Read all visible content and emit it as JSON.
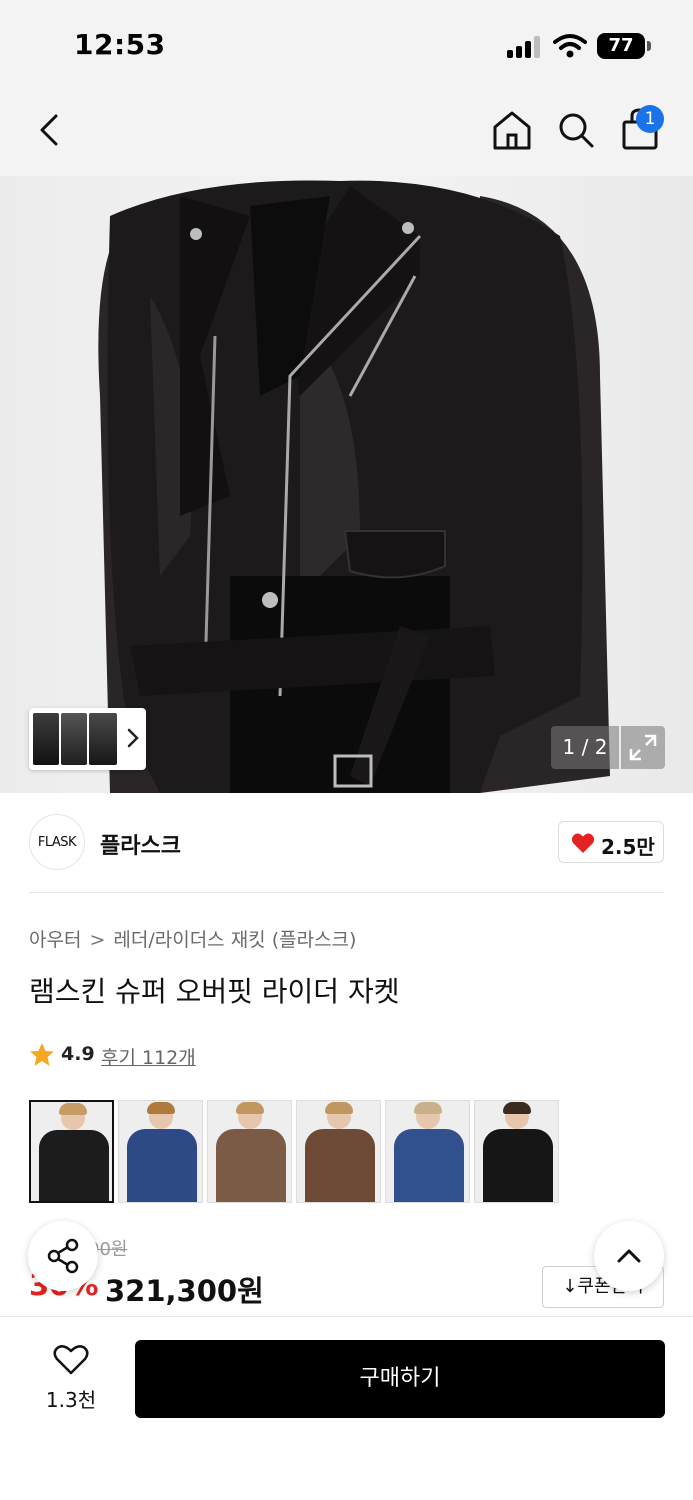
{
  "status_bar": {
    "time": "12:53",
    "battery": "77"
  },
  "header": {
    "back_icon": "chevron-left-icon",
    "home_icon": "home-icon",
    "search_icon": "search-icon",
    "cart_icon": "shopping-bag-icon",
    "cart_count": "1",
    "badge_color": "#1a73e8"
  },
  "gallery": {
    "page_indicator": "1 / 2",
    "expand_icon": "expand-icon",
    "thumbnail_chevron_icon": "chevron-right-icon"
  },
  "brand": {
    "logo_text": "FLASK",
    "name": "플라스크",
    "likes": "2.5만",
    "heart_color": "#e52222"
  },
  "product": {
    "breadcrumb": [
      "아우터",
      "레더/라이더스 재킷 (플라스크)"
    ],
    "title": "램스킨 슈퍼 오버핏 라이더 자켓",
    "rating": "4.9",
    "reviews_label": "후기 112개",
    "star_color": "#f5a623"
  },
  "variants": [
    {
      "name": "black",
      "body_color": "#1c1c1c",
      "hair_color": "#c89c66",
      "selected": true
    },
    {
      "name": "navy",
      "body_color": "#2e4a86",
      "hair_color": "#b07a3e",
      "selected": false
    },
    {
      "name": "brown",
      "body_color": "#7b5a46",
      "hair_color": "#c2965f",
      "selected": false
    },
    {
      "name": "brown-dark",
      "body_color": "#6d4a36",
      "hair_color": "#c2965f",
      "selected": false
    },
    {
      "name": "blue",
      "body_color": "#32508e",
      "hair_color": "#c9b08a",
      "selected": false
    },
    {
      "name": "black-2",
      "body_color": "#161616",
      "hair_color": "#3a2a20",
      "selected": false
    }
  ],
  "price": {
    "original": "00원",
    "discount": "30%",
    "sale": "321,300원",
    "coupon_label": "↓쿠폰받기",
    "discount_color": "#e52222"
  },
  "floating": {
    "share_icon": "share-icon",
    "scroll_top_icon": "chevron-up-icon"
  },
  "bottom_bar": {
    "wishlist_icon": "heart-outline-icon",
    "wishlist_count": "1.3천",
    "buy_label": "구매하기"
  }
}
